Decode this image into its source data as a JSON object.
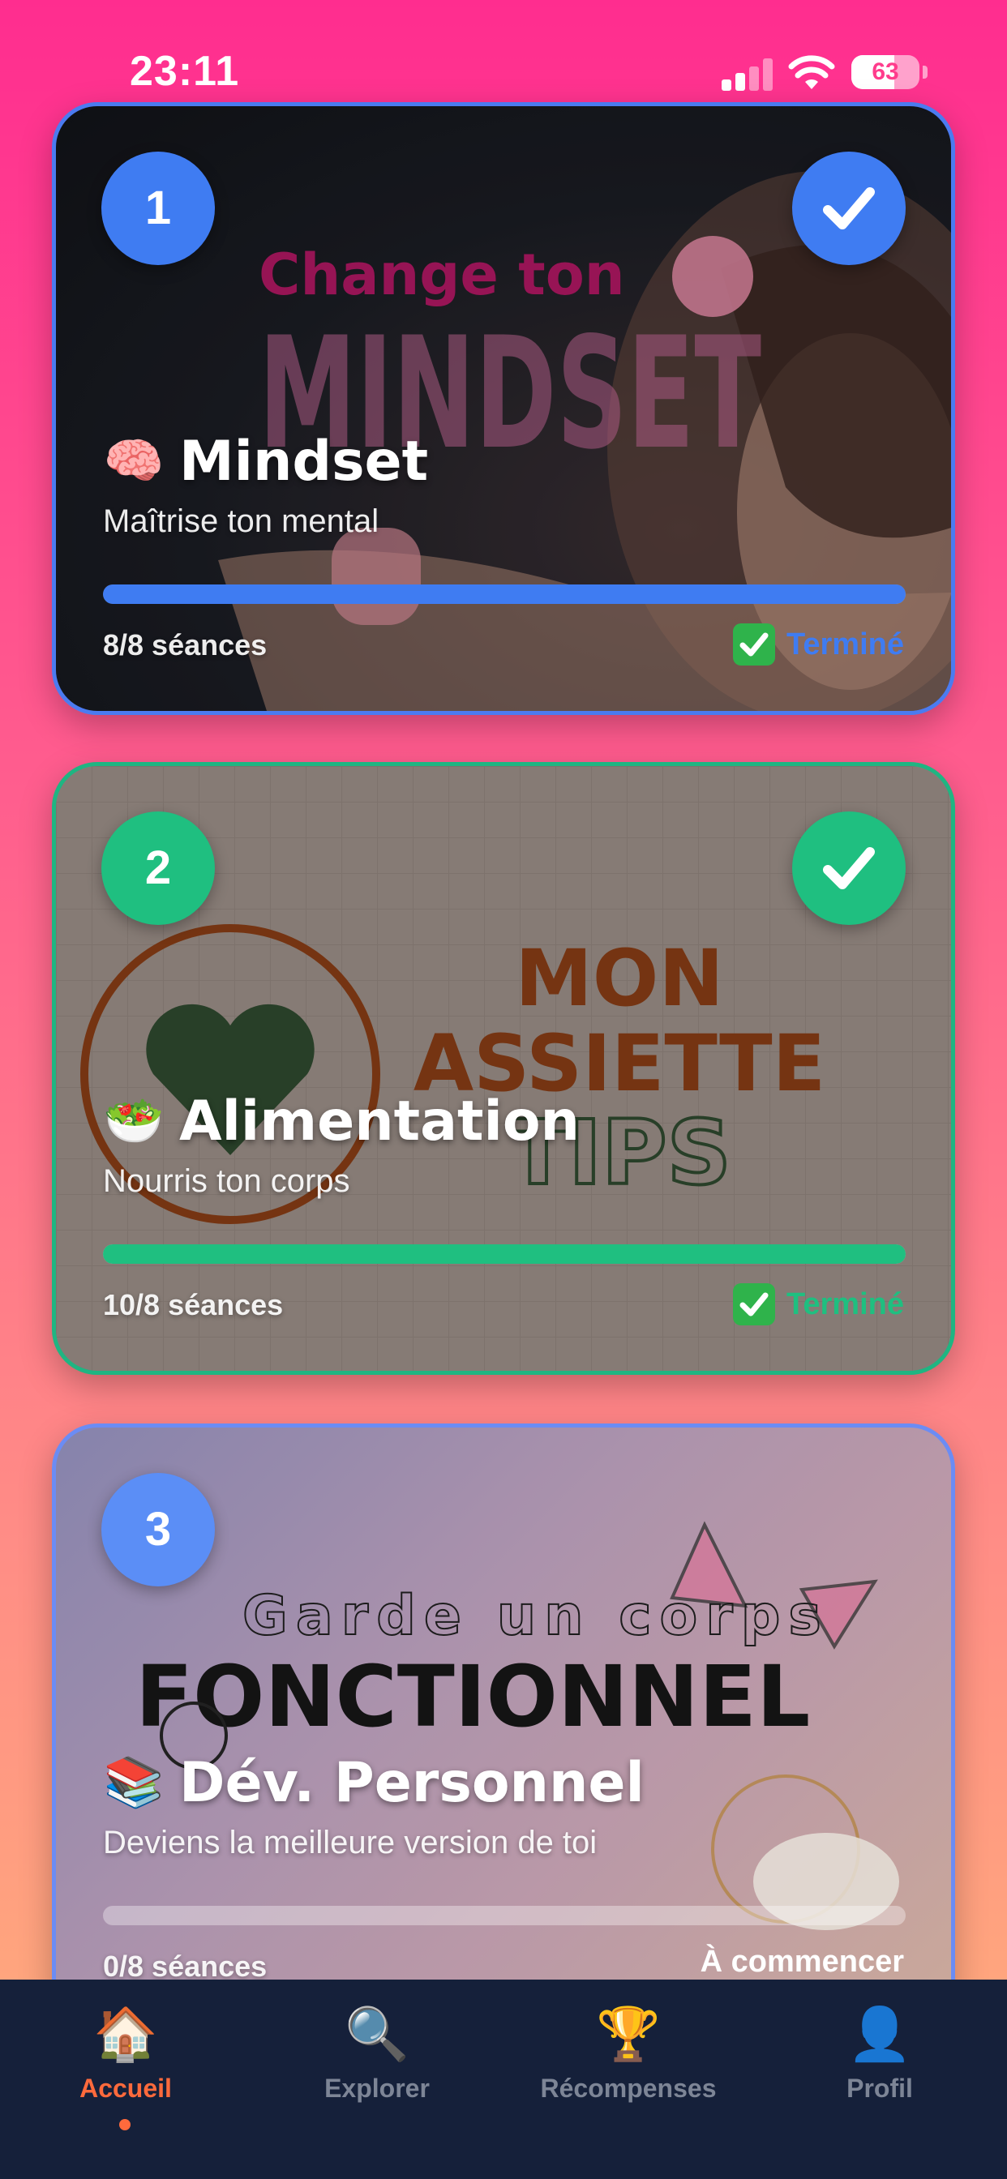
{
  "status_bar": {
    "time": "23:11",
    "battery": "63"
  },
  "cards": [
    {
      "number": "1",
      "emoji": "🧠",
      "title": "Mindset",
      "subtitle": "Maîtrise ton mental",
      "sessions": "8/8 séances",
      "status": "Terminé",
      "completed": true,
      "progress": 1.0,
      "accent": "#3f7cf2",
      "art": {
        "line1": "Change ton",
        "line2": "MINDSET"
      }
    },
    {
      "number": "2",
      "emoji": "🥗",
      "title": "Alimentation",
      "subtitle": "Nourris ton corps",
      "sessions": "10/8 séances",
      "status": "Terminé",
      "completed": true,
      "progress": 1.0,
      "accent": "#1fbf80",
      "art": {
        "line1": "MON",
        "line2": "ASSIETTE",
        "line3": "TIPS"
      }
    },
    {
      "number": "3",
      "emoji": "📚",
      "title": "Dév. Personnel",
      "subtitle": "Deviens la meilleure version de toi",
      "sessions": "0/8 séances",
      "status": "À commencer",
      "completed": false,
      "progress": 0.0,
      "accent": "#5b8ef6",
      "art": {
        "line1": "Garde un corps",
        "line2": "FONCTIONNEL"
      }
    }
  ],
  "tab_bar": {
    "tabs": [
      {
        "label": "Accueil",
        "icon": "house-icon",
        "active": true
      },
      {
        "label": "Explorer",
        "icon": "magnifier-icon",
        "active": false
      },
      {
        "label": "Récompenses",
        "icon": "trophy-icon",
        "active": false
      },
      {
        "label": "Profil",
        "icon": "person-icon",
        "active": false
      }
    ]
  }
}
